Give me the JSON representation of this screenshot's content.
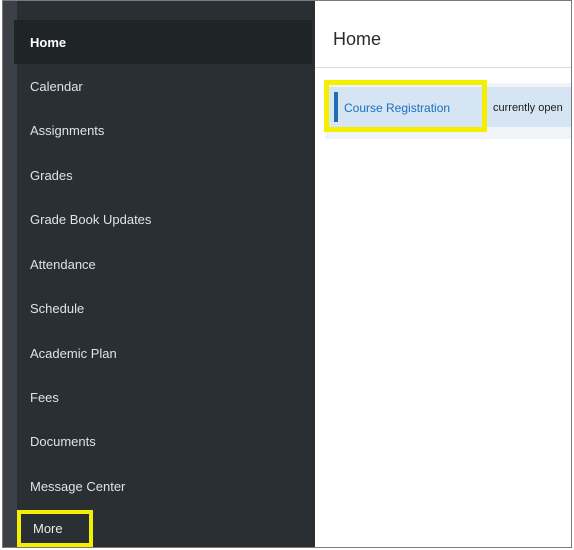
{
  "sidebar": {
    "items": [
      {
        "label": "Home"
      },
      {
        "label": "Calendar"
      },
      {
        "label": "Assignments"
      },
      {
        "label": "Grades"
      },
      {
        "label": "Grade Book Updates"
      },
      {
        "label": "Attendance"
      },
      {
        "label": "Schedule"
      },
      {
        "label": "Academic Plan"
      },
      {
        "label": "Fees"
      },
      {
        "label": "Documents"
      },
      {
        "label": "Message Center"
      },
      {
        "label": "More"
      }
    ]
  },
  "main": {
    "title": "Home",
    "notice": {
      "link_label": "Course Registration",
      "text": "currently open"
    }
  },
  "colors": {
    "sidebar_bg": "#2a2f33",
    "active_accent": "#8db33a",
    "highlight": "#f4ee00",
    "link": "#1d6fbf",
    "notice_bg": "#d5e5f3"
  }
}
